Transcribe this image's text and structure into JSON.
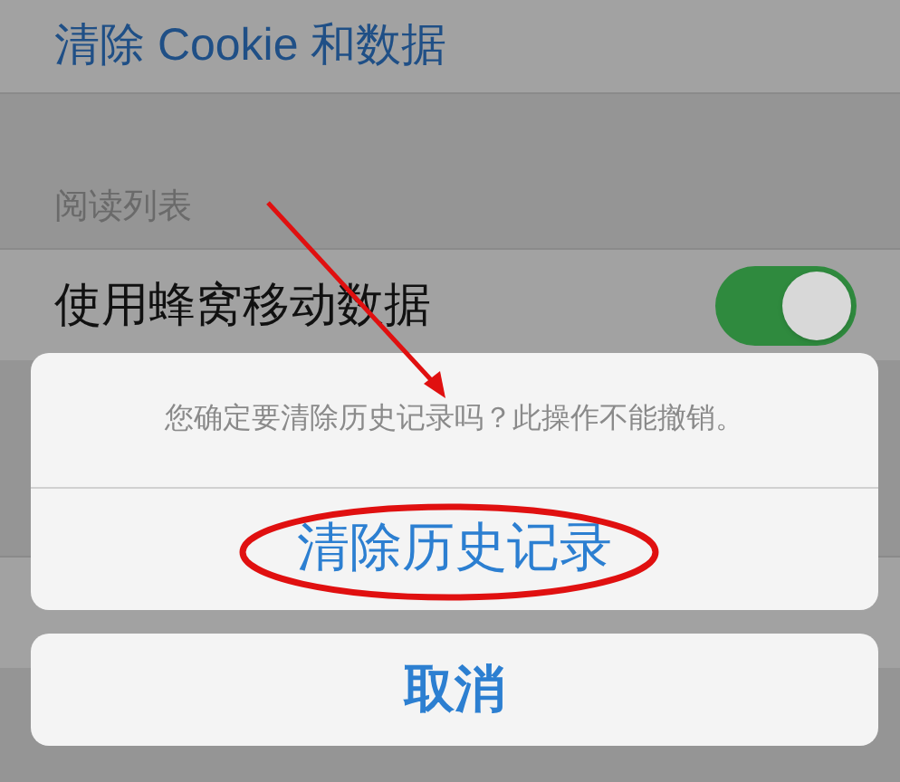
{
  "settings": {
    "clear_cookies": "清除 Cookie 和数据",
    "section_header": "阅读列表",
    "cellular_row": {
      "label": "使用蜂窝移动数据",
      "on": true
    }
  },
  "action_sheet": {
    "message": "您确定要清除历史记录吗？此操作不能撤销。",
    "destructive_button": "清除历史记录",
    "cancel_button": "取消"
  }
}
